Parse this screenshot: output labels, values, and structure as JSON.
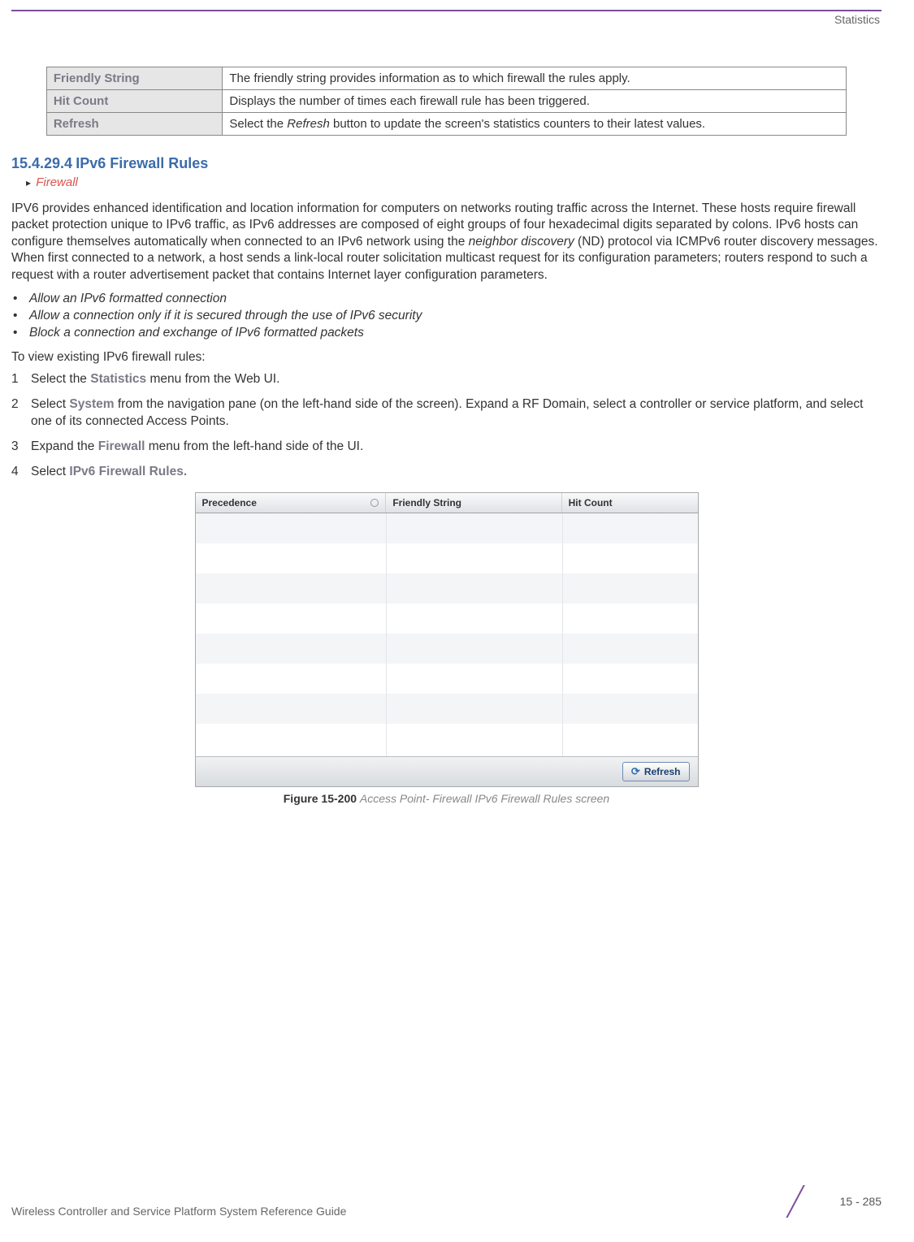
{
  "header": {
    "section": "Statistics"
  },
  "def_table": [
    {
      "term": "Friendly String",
      "desc": "The friendly string provides information as to which firewall the rules apply."
    },
    {
      "term": "Hit Count",
      "desc": "Displays the number of times each firewall rule has been triggered."
    },
    {
      "term": "Refresh",
      "desc_prefix": "Select the ",
      "desc_em": "Refresh",
      "desc_suffix": " button to update the screen's statistics counters to their latest values."
    }
  ],
  "section": {
    "number": "15.4.29.4",
    "title": "IPv6 Firewall Rules"
  },
  "breadcrumb": "Firewall",
  "paragraph": {
    "pre": "IPV6 provides enhanced identification and location information for computers on networks routing traffic across the Internet. These hosts require firewall packet protection unique to IPv6 traffic, as IPv6 addresses are composed of eight groups of four hexadecimal digits separated by colons. IPv6 hosts can configure themselves automatically when connected to an IPv6 network using the ",
    "em": "neighbor discovery",
    "post": " (ND) protocol via ICMPv6 router discovery messages. When first connected to a network, a host sends a link-local router solicitation multicast request for its configuration parameters; routers respond to such a request with a router advertisement packet that contains Internet layer configuration parameters."
  },
  "bullets": [
    "Allow an IPv6 formatted connection",
    "Allow a connection only if it is secured through the use of IPv6 security",
    "Block a connection and exchange of IPv6 formatted packets"
  ],
  "lead": "To view existing IPv6 firewall rules:",
  "steps": [
    {
      "n": "1",
      "pre": "Select the ",
      "strong": "Statistics",
      "post": " menu from the Web UI."
    },
    {
      "n": "2",
      "pre": "Select ",
      "strong": "System",
      "post": " from the navigation pane (on the left-hand side of the screen). Expand a RF Domain, select a controller or service platform, and select one of its connected Access Points."
    },
    {
      "n": "3",
      "pre": "Expand the ",
      "strong": "Firewall",
      "post": " menu from the left-hand side of the UI."
    },
    {
      "n": "4",
      "pre": "Select ",
      "strong": "IPv6 Firewall Rules.",
      "post": ""
    }
  ],
  "mock": {
    "columns": [
      "Precedence",
      "Friendly String",
      "Hit Count"
    ],
    "refresh_label": "Refresh"
  },
  "figure": {
    "label": "Figure 15-200",
    "caption": "Access Point- Firewall IPv6 Firewall Rules screen"
  },
  "footer": {
    "left": "Wireless Controller and Service Platform System Reference Guide",
    "page": "15 - 285"
  }
}
